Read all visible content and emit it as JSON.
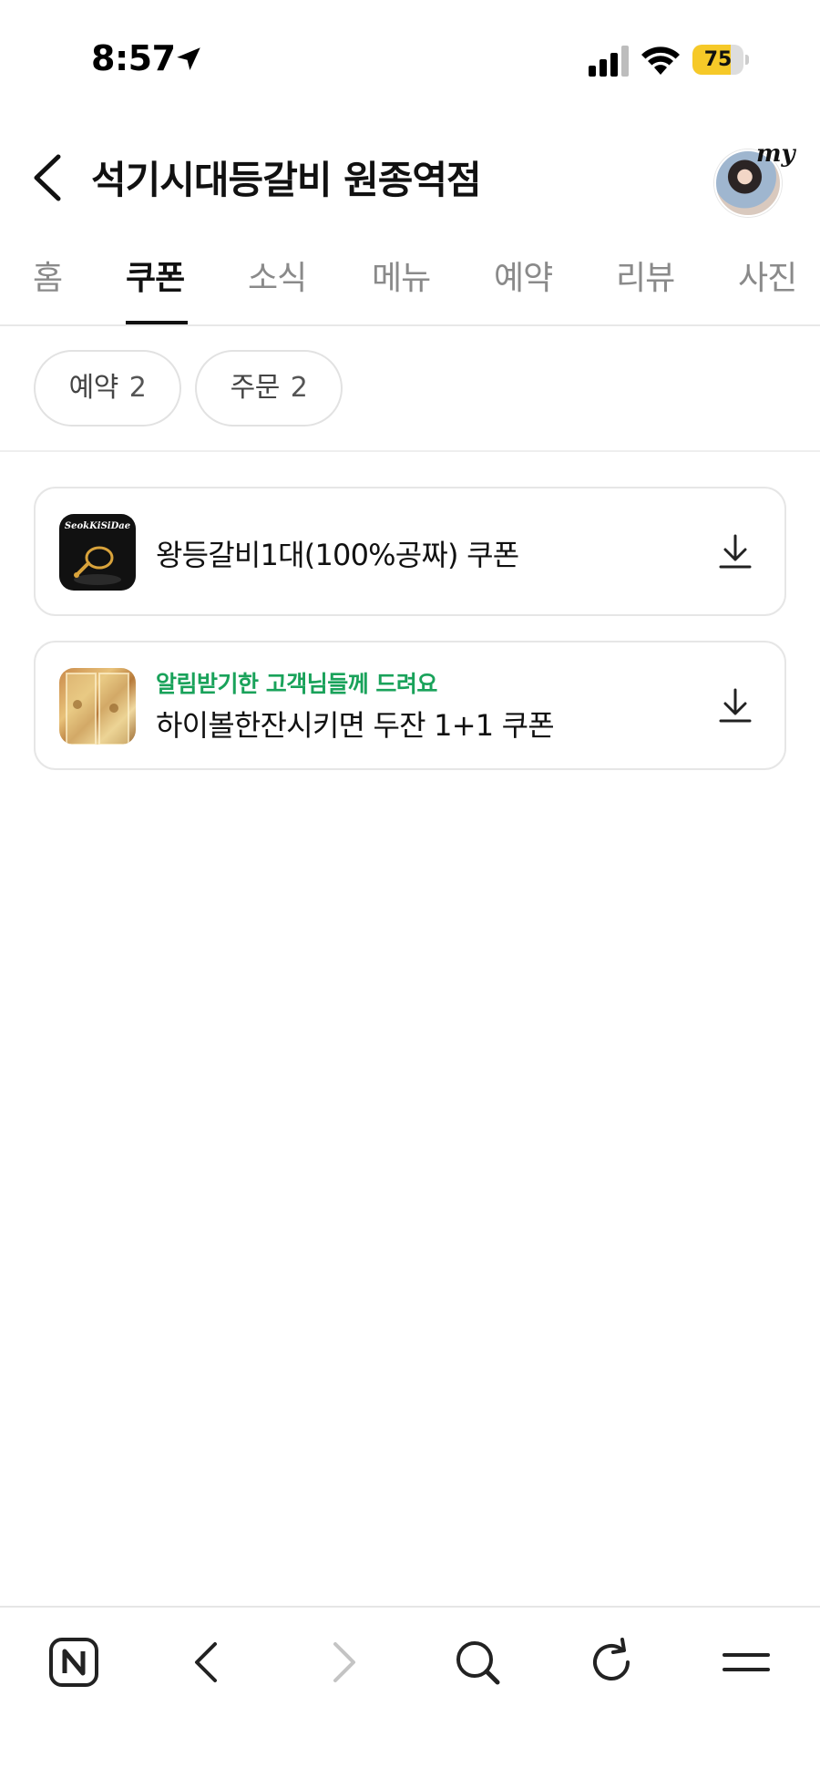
{
  "status_bar": {
    "time": "8:57",
    "battery_level": "75",
    "battery_color": "#f6c928",
    "icons": [
      "location-arrow-icon",
      "signal-icon",
      "wifi-icon",
      "battery-icon"
    ]
  },
  "header": {
    "title": "석기시대등갈비 원종역점",
    "my_label": "my",
    "back_icon": "chevron-left-icon"
  },
  "tabs": [
    {
      "label": "홈",
      "active": false
    },
    {
      "label": "쿠폰",
      "active": true
    },
    {
      "label": "소식",
      "active": false
    },
    {
      "label": "메뉴",
      "active": false
    },
    {
      "label": "예약",
      "active": false
    },
    {
      "label": "리뷰",
      "active": false
    },
    {
      "label": "사진",
      "active": false
    }
  ],
  "filters": [
    {
      "label": "예약",
      "count": "2"
    },
    {
      "label": "주문",
      "count": "2"
    }
  ],
  "coupons": [
    {
      "subtitle": "",
      "title": "왕등갈비1대(100%공짜) 쿠폰",
      "thumb_logo": "SeokKiSiDae",
      "action_icon": "download-icon"
    },
    {
      "subtitle": "알림받기한 고객님들께 드려요",
      "title": "하이볼한잔시키면 두잔 1+1 쿠폰",
      "action_icon": "download-icon"
    }
  ],
  "colors": {
    "accent_green": "#19a25a",
    "text_primary": "#111111",
    "text_muted": "#8a8a8a"
  },
  "toolbar": {
    "icons": [
      "naver-n-icon",
      "back-chevron-icon",
      "forward-chevron-icon",
      "search-icon",
      "refresh-icon",
      "menu-icon"
    ]
  }
}
